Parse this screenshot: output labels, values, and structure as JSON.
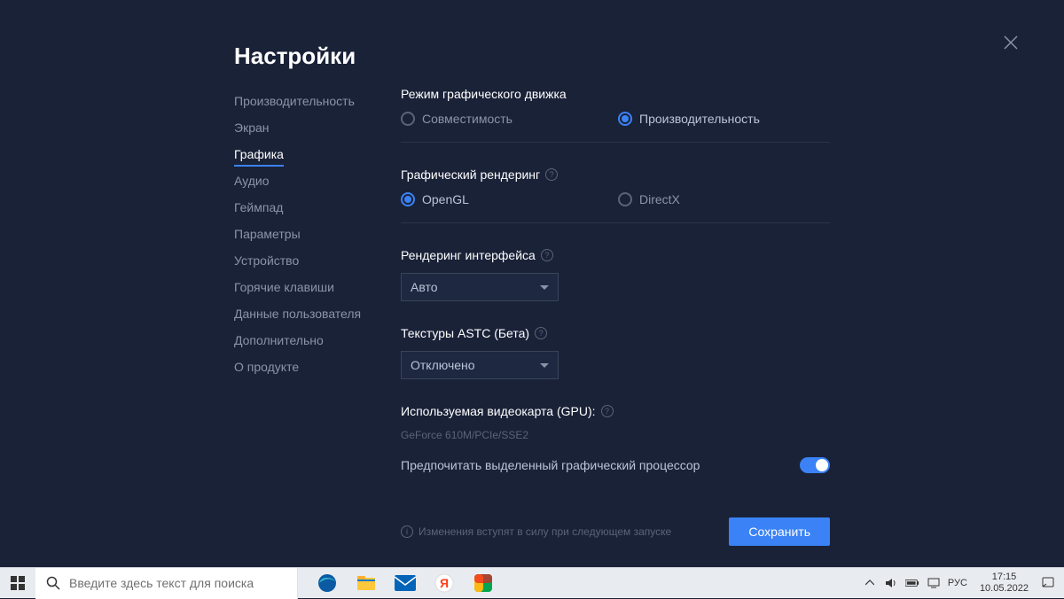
{
  "title": "Настройки",
  "sidebar": {
    "items": [
      {
        "label": "Производительность"
      },
      {
        "label": "Экран"
      },
      {
        "label": "Графика"
      },
      {
        "label": "Аудио"
      },
      {
        "label": "Геймпад"
      },
      {
        "label": "Параметры"
      },
      {
        "label": "Устройство"
      },
      {
        "label": "Горячие клавиши"
      },
      {
        "label": "Данные пользователя"
      },
      {
        "label": "Дополнительно"
      },
      {
        "label": "О продукте"
      }
    ],
    "active_index": 2
  },
  "sections": {
    "engine": {
      "title": "Режим графического движка",
      "options": [
        "Совместимость",
        "Производительность"
      ],
      "selected": 1
    },
    "renderer": {
      "title": "Графический рендеринг",
      "options": [
        "OpenGL",
        "DirectX"
      ],
      "selected": 0
    },
    "interface": {
      "title": "Рендеринг интерфейса",
      "value": "Авто"
    },
    "astc": {
      "title": "Текстуры ASTC (Бета)",
      "value": "Отключено"
    },
    "gpu": {
      "title": "Используемая видеокарта (GPU):",
      "info": "GeForce 610M/PCIe/SSE2",
      "toggle_label": "Предпочитать выделенный графический процессор",
      "toggle_on": true
    }
  },
  "footer": {
    "info": "Изменения вступят в силу при следующем запуске",
    "save": "Сохранить"
  },
  "taskbar": {
    "search_placeholder": "Введите здесь текст для поиска",
    "lang": "РУС",
    "time": "17:15",
    "date": "10.05.2022"
  }
}
